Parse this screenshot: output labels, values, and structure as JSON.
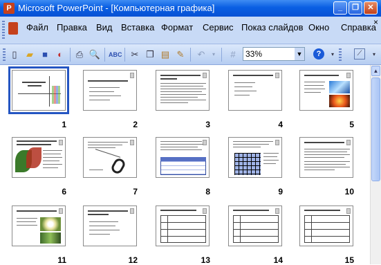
{
  "window": {
    "title": "Microsoft PowerPoint - [Компьютерная графика]",
    "app_icon": "powerpoint-icon",
    "controls": [
      "minimize",
      "restore",
      "close"
    ]
  },
  "menu": {
    "items": [
      "Файл",
      "Правка",
      "Вид",
      "Вставка",
      "Формат",
      "Сервис",
      "Показ слайдов",
      "Окно",
      "Справка"
    ],
    "close_glyph": "×"
  },
  "toolbar": {
    "zoom_value": "33%",
    "icons": [
      "new-icon",
      "open-icon",
      "save-icon",
      "permission-icon",
      "print-icon",
      "print-preview-icon",
      "spelling-icon",
      "cut-icon",
      "copy-icon",
      "paste-icon",
      "format-painter-icon",
      "undo-icon",
      "table-grid-icon",
      "zoom-dropdown",
      "help-icon"
    ]
  },
  "slides": {
    "selected": "1",
    "numbers": [
      "1",
      "2",
      "3",
      "4",
      "5",
      "6",
      "7",
      "8",
      "9",
      "10",
      "11",
      "12",
      "13",
      "14",
      "15"
    ]
  },
  "colors": {
    "titlebar": "#0a5fe3",
    "menubar": "#c8daf6",
    "selection": "#2455c2"
  }
}
